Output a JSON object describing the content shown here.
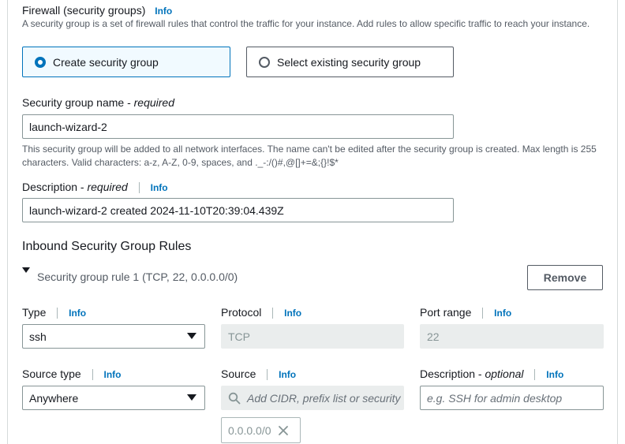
{
  "firewall": {
    "title": "Firewall (security groups)",
    "info": "Info",
    "description": "A security group is a set of firewall rules that control the traffic for your instance. Add rules to allow specific traffic to reach your instance.",
    "option_create": "Create security group",
    "option_select": "Select existing security group",
    "selected": "create"
  },
  "sg_name": {
    "label": "Security group name - ",
    "label_italic": "required",
    "value": "launch-wizard-2",
    "hint": "This security group will be added to all network interfaces. The name can't be edited after the security group is created. Max length is 255 characters. Valid characters: a-z, A-Z, 0-9, spaces, and ._-:/()#,@[]+=&;{}!$*"
  },
  "description": {
    "label": "Description - ",
    "label_italic": "required",
    "info": "Info",
    "value": "launch-wizard-2 created 2024-11-10T20:39:04.439Z"
  },
  "inbound": {
    "heading": "Inbound Security Group Rules",
    "rule_title": "Security group rule 1 (TCP, 22, 0.0.0.0/0)",
    "remove_label": "Remove",
    "type_label": "Type",
    "type_value": "ssh",
    "protocol_label": "Protocol",
    "protocol_value": "TCP",
    "port_label": "Port range",
    "port_value": "22",
    "source_type_label": "Source type",
    "source_type_value": "Anywhere",
    "source_label": "Source",
    "source_placeholder": "Add CIDR, prefix list or security",
    "source_token": "0.0.0.0/0",
    "desc_label": "Description - ",
    "desc_label_italic": "optional",
    "desc_placeholder": "e.g. SSH for admin desktop",
    "info": "Info"
  }
}
